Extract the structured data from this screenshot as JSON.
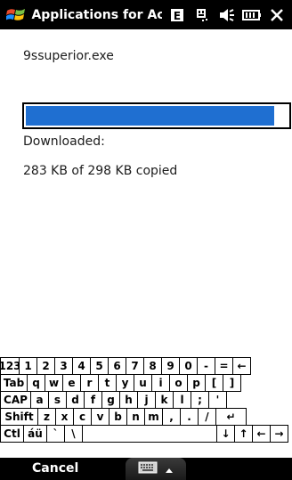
{
  "window": {
    "title": "Applications for Ac",
    "start_icon": "windows-flag-icon",
    "status_icons": [
      "data-connection-icon",
      "signal-icon",
      "volume-icon",
      "battery-icon",
      "close-icon"
    ]
  },
  "main": {
    "filename": "9ssuperior.exe",
    "progress": 0.95,
    "progress_color": "#1f6fd1",
    "status_label": "Downloaded:",
    "copied_text": "283 KB of 298 KB copied"
  },
  "keyboard": {
    "rows": [
      [
        "123",
        "1",
        "2",
        "3",
        "4",
        "5",
        "6",
        "7",
        "8",
        "9",
        "0",
        "-",
        "=",
        "←"
      ],
      [
        "Tab",
        "q",
        "w",
        "e",
        "r",
        "t",
        "y",
        "u",
        "i",
        "o",
        "p",
        "[",
        "]"
      ],
      [
        "CAP",
        "a",
        "s",
        "d",
        "f",
        "g",
        "h",
        "j",
        "k",
        "l",
        ";",
        "'"
      ],
      [
        "Shift",
        "z",
        "x",
        "c",
        "v",
        "b",
        "n",
        "m",
        ",",
        ".",
        "/",
        "↵"
      ],
      [
        "Ctl",
        "áü",
        "`",
        "\\",
        "",
        "↓",
        "↑",
        "←",
        "→"
      ]
    ]
  },
  "menubar": {
    "left_softkey": "Cancel",
    "sip_icon": "keyboard-icon",
    "sip_arrow": "chevron-up-icon"
  }
}
